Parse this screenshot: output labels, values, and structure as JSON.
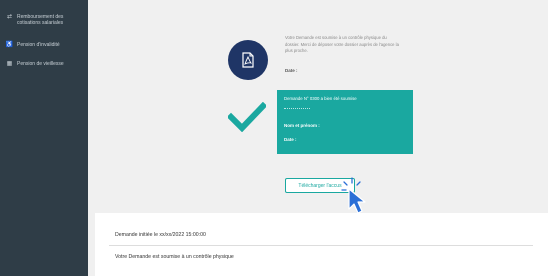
{
  "sidebar": {
    "items": [
      {
        "label": "Remboursement des cotisations salariales",
        "icon": "exchange-icon"
      },
      {
        "label": "Pension d'invalidité",
        "icon": "wheelchair-icon"
      },
      {
        "label": "Pension de vieillesse",
        "icon": "grid-icon"
      }
    ]
  },
  "status": {
    "message": "Votre Demande est soumise à un contrôle physique du dossier. Merci de déposer votre dossier auprès de l'agence la plus proche.",
    "date_label": "Date :"
  },
  "confirmation": {
    "request_line": "Demande N° 0300 a bien été soumise",
    "separator": "------------",
    "name_label": "Nom et prénom :",
    "date_label": "Date :"
  },
  "download_button": {
    "label": "Télécharger l'accus"
  },
  "history": {
    "rows": [
      "Demande initiée le xx/xx/2022 15:00:00",
      "Votre Demande est soumise à un contrôle physique"
    ]
  },
  "colors": {
    "sidebar": "#2f3d47",
    "teal": "#1aa8a0",
    "navy": "#1f3566",
    "cursor": "#2b6fd6"
  }
}
